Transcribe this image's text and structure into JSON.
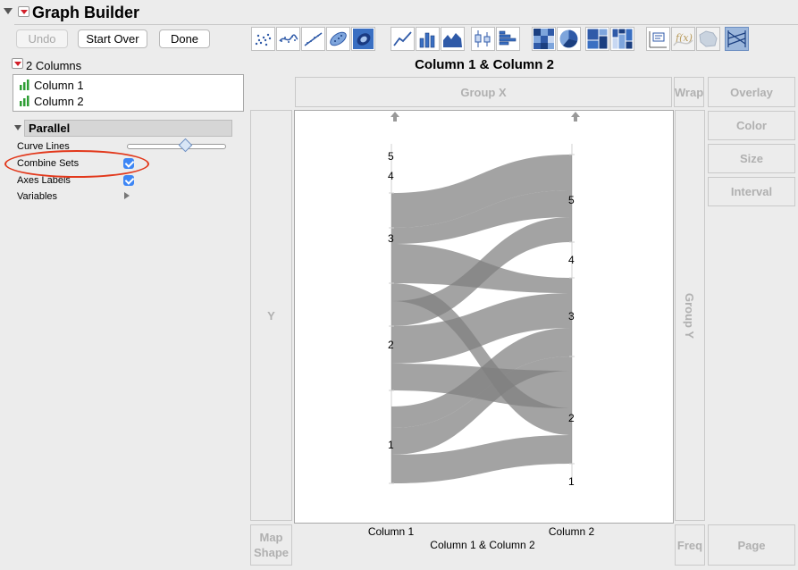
{
  "window": {
    "title": "Graph Builder"
  },
  "toolbar": {
    "undo": "Undo",
    "start_over": "Start Over",
    "done": "Done"
  },
  "columns": {
    "header": "2 Columns",
    "items": [
      "Column 1",
      "Column 2"
    ]
  },
  "parallel": {
    "title": "Parallel",
    "curve_lines": "Curve Lines",
    "combine_sets": "Combine Sets",
    "axes_labels": "Axes Labels",
    "variables": "Variables",
    "combine_sets_checked": true,
    "axes_labels_checked": true,
    "curve_lines_slider_fraction": 0.6
  },
  "zones": {
    "group_x": "Group X",
    "wrap": "Wrap",
    "overlay": "Overlay",
    "color": "Color",
    "size": "Size",
    "interval": "Interval",
    "y": "Y",
    "group_y": "Group Y",
    "map_shape_1": "Map",
    "map_shape_2": "Shape",
    "freq": "Freq",
    "page": "Page"
  },
  "accent_colors": {
    "ribbon": "#7f7f7f",
    "highlight_ellipse": "#e2381b",
    "checkbox": "#3d86f5",
    "selected_icon": "#9cb7dc"
  },
  "chart_data": {
    "type": "parallel",
    "title": "Column 1 & Column 2",
    "xlabel": "Column 1 & Column 2",
    "axes": [
      "Column 1",
      "Column 2"
    ],
    "axis_1_ticks": [
      "1",
      "2",
      "3",
      "4",
      "5"
    ],
    "axis_2_ticks": [
      "1",
      "2",
      "3",
      "4",
      "5"
    ]
  },
  "icons": [
    "scatter-points-icon",
    "smoother-icon",
    "line-fit-icon",
    "ellipse-icon",
    "contour-icon",
    "line-icon",
    "bar-icon",
    "area-icon",
    "box-plot-icon",
    "histogram-icon",
    "heatmap-icon",
    "pie-icon",
    "treemap-icon",
    "mosaic-icon",
    "caption-box-icon",
    "formula-icon",
    "map-shape-icon",
    "parallel-plot-icon"
  ]
}
